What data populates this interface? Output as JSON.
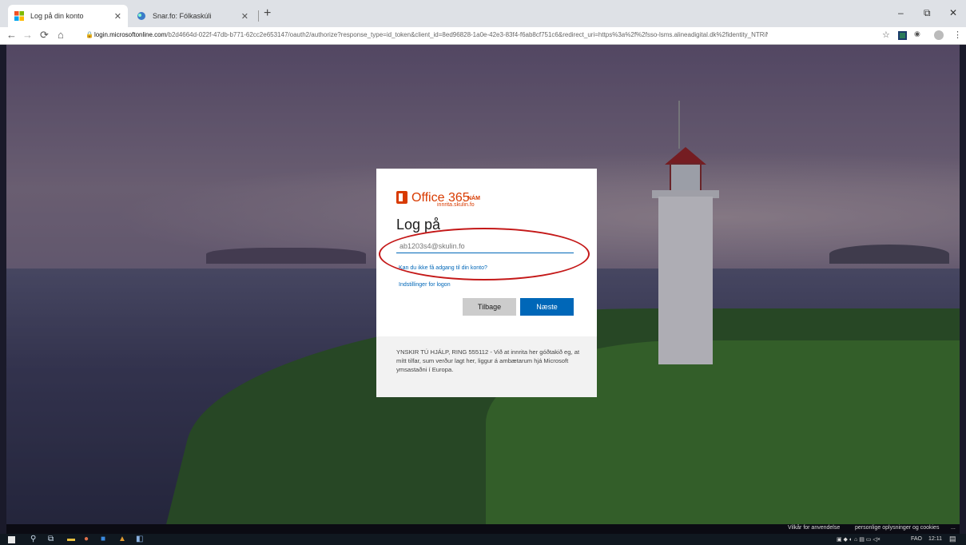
{
  "browser": {
    "tabs": [
      {
        "title": "Log på din konto",
        "active": true
      },
      {
        "title": "Snar.fo: Fólkaskúli",
        "active": false
      }
    ],
    "new_tab": "+",
    "window_controls": {
      "minimize": "–",
      "restore": "⧉",
      "close": "✕"
    },
    "nav": {
      "back": "←",
      "forward": "→",
      "reload": "⟳",
      "home": "⌂"
    },
    "url_host": "login.microsoftonline.com",
    "url_path": "/b2d4664d-022f-47db-b771-62cc2e653147/oauth2/authorize?response_type=id_token&client_id=8ed96828-1a0e-42e3-83f4-f6ab8cf751c6&redirect_uri=https%3a%2f%2fsso-lsms.alineadigital.dk%2fidentity_NTRiNTdkOTYtN...",
    "bookmark_star": "☆",
    "menu_icon": "⋮"
  },
  "login": {
    "brand": "Office 365",
    "brand_sup": "NÁM",
    "brand_sub": "innrita.skulin.fo",
    "heading": "Log på",
    "email_value": "ab1203s4@skulin.fo",
    "link_no_access": "Kan du ikke få adgang til din konto?",
    "link_options": "Indstillinger for logon",
    "back_button": "Tilbage",
    "next_button": "Næste",
    "footer_text": "YNSKIR TÚ HJÁLP, RING 555112 - Við at innrita her góðtakið eg, at mítt tilfar, sum verður lagt her, liggur á ambætarum hjá Microsoft ymsastaðni í Europa."
  },
  "page_footer": {
    "terms": "Vilkår for anvendelse",
    "privacy": "personlige oplysninger og cookies",
    "more": "..."
  },
  "taskbar": {
    "language": "FAO",
    "time": "12:11"
  },
  "colors": {
    "accent_blue": "#0067b8",
    "office_orange": "#d83b01",
    "annotation_red": "#c41818"
  }
}
